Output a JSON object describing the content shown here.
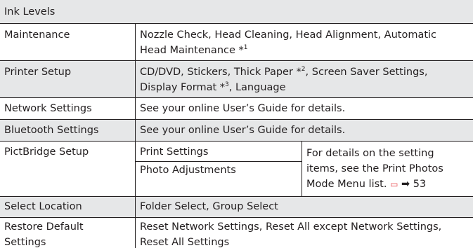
{
  "rows": {
    "ink_levels": {
      "label": "Ink Levels"
    },
    "maintenance": {
      "label": "Maintenance",
      "value_line1": "Nozzle Check, Head Cleaning, Head Alignment, Automatic",
      "value_line2": "Head Maintenance *",
      "note_mark": "1"
    },
    "printer_setup": {
      "label": "Printer Setup",
      "value_line1_a": "CD/DVD, Stickers, Thick Paper *",
      "note_mark_a": "2",
      "value_line1_b": ", Screen Saver Settings,",
      "value_line2_a": "Display Format *",
      "note_mark_b": "3",
      "value_line2_b": ", Language"
    },
    "network_settings": {
      "label": "Network Settings",
      "value": "See your online User’s Guide for details."
    },
    "bluetooth_settings": {
      "label": "Bluetooth Settings",
      "value": "See your online User’s Guide for details."
    },
    "pictbridge_setup": {
      "label": "PictBridge Setup",
      "sub1": "Print Settings",
      "sub2": "Photo Adjustments",
      "note_line1": "For details on the setting",
      "note_line2": "items, see the Print Photos",
      "note_line3": "Mode Menu list.",
      "arrow": "➡",
      "page": "53"
    },
    "select_location": {
      "label": "Select Location",
      "value": "Folder Select, Group Select"
    },
    "restore_default": {
      "label_line1": "Restore Default",
      "label_line2": "Settings",
      "value_line1": "Reset Network Settings, Reset All except Network Settings,",
      "value_line2": "Reset All Settings"
    }
  },
  "colors": {
    "shade": "#e6e7e8",
    "rule": "#231f20",
    "book_icon": "#e8474c"
  }
}
